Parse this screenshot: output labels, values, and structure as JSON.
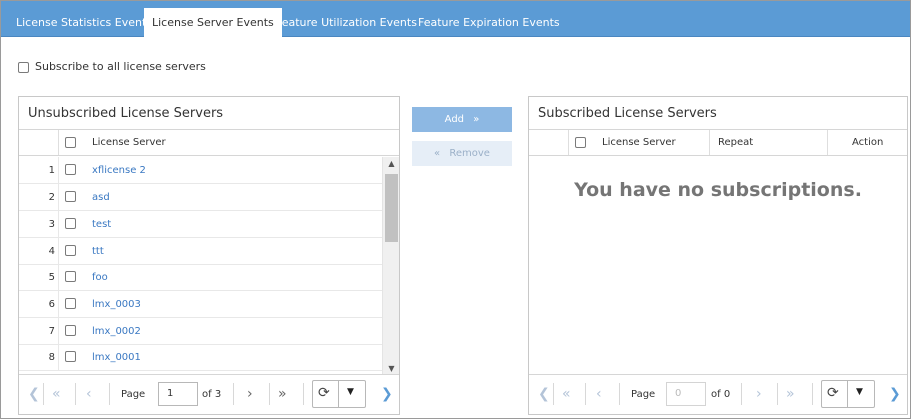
{
  "tabs": [
    {
      "label": "License Statistics Events",
      "active": false
    },
    {
      "label": "License Server Events",
      "active": true
    },
    {
      "label": "Feature Utilization Events",
      "active": false
    },
    {
      "label": "Feature Expiration Events",
      "active": false
    }
  ],
  "subscribe_all": {
    "label": "Subscribe to all license servers",
    "checked": false
  },
  "unsubscribed": {
    "title": "Unsubscribed License Servers",
    "column_header": "License Server",
    "rows": [
      {
        "num": "1",
        "name": "xflicense 2"
      },
      {
        "num": "2",
        "name": "asd"
      },
      {
        "num": "3",
        "name": "test"
      },
      {
        "num": "4",
        "name": "ttt"
      },
      {
        "num": "5",
        "name": "foo"
      },
      {
        "num": "6",
        "name": "lmx_0003"
      },
      {
        "num": "7",
        "name": "lmx_0002"
      },
      {
        "num": "8",
        "name": "lmx_0001"
      }
    ],
    "pager": {
      "page_label": "Page",
      "page_value": "1",
      "of_label": "of 3"
    }
  },
  "buttons": {
    "add": "Add",
    "remove": "Remove"
  },
  "subscribed": {
    "title": "Subscribed License Servers",
    "columns": {
      "server": "License Server",
      "repeat": "Repeat",
      "action": "Action"
    },
    "empty_message": "You have no subscriptions.",
    "pager": {
      "page_label": "Page",
      "page_value": "0",
      "of_label": "of 0"
    }
  },
  "colors": {
    "tabbar": "#5b9bd5",
    "link": "#3a78c2",
    "add_button": "#8db8e3"
  },
  "icons": {
    "first": "double-left-icon",
    "prev": "chevron-left-icon",
    "next": "chevron-right-icon",
    "last": "double-right-icon",
    "refresh": "refresh-icon",
    "dropdown": "caret-down-icon"
  }
}
